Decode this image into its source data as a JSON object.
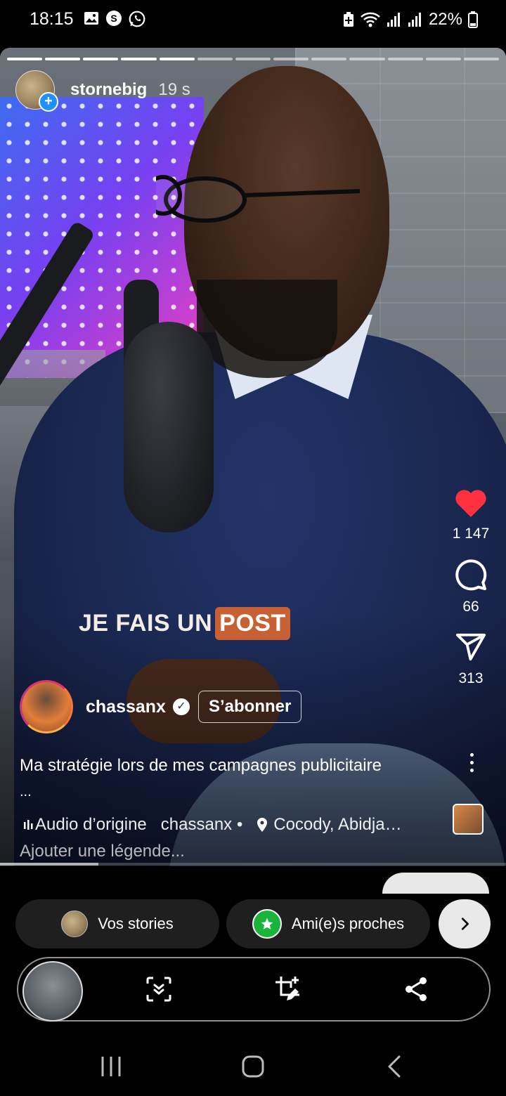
{
  "status_bar": {
    "time": "18:15",
    "battery": "22%",
    "left_icons": [
      "image-icon",
      "s-app-icon",
      "whatsapp-icon"
    ],
    "right_icons": [
      "battery-saver-icon",
      "wifi-icon",
      "signal-icon",
      "signal-icon",
      "battery-icon"
    ]
  },
  "story": {
    "author": "stornebig",
    "time_ago": "19 s",
    "overlay_text": "JE FAIS UN",
    "overlay_highlight": "POST",
    "likes": "1 147",
    "comments": "66",
    "shares": "313",
    "creator": "chassanx",
    "follow_label": "S’abonner",
    "caption": "Ma stratégie lors de mes campagnes publicitaire",
    "caption_more": "...",
    "audio_label": "Audio d’origine",
    "audio_author": "chassanx •",
    "location": "Cocody, Abidja…",
    "add_caption": "Ajouter une légende..."
  },
  "share": {
    "your_stories": "Vos stories",
    "close_friends": "Ami(e)s proches"
  },
  "colors": {
    "like_red": "#ff3040",
    "close_friends_green": "#18b53a",
    "highlight_orange": "#c76033"
  }
}
